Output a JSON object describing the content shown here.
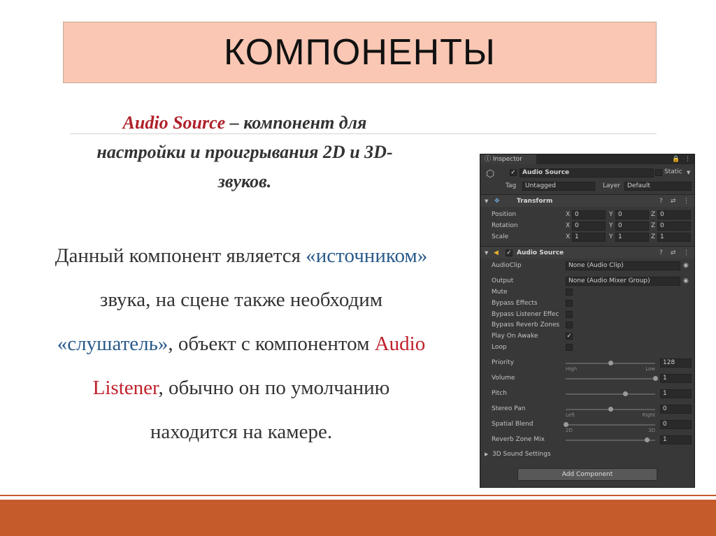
{
  "slide": {
    "title": "КОМПОНЕНТЫ",
    "para1": {
      "term": "Audio Source",
      "rest_line1": " – компонент для",
      "line2": "настройки и проигрывания 2D и 3D-",
      "line3": "звуков."
    },
    "para2": {
      "l1_a": "Данный компонент является ",
      "l1_b": "«источником»",
      "l2": "звука, на сцене также необходим",
      "l3_a": "«слушатель»",
      "l3_b": ", объект с компонентом ",
      "l3_c": "Audio",
      "l4_a": "Listener",
      "l4_b": ", обычно он по умолчанию",
      "l5": "находится на камере."
    }
  },
  "inspector": {
    "tab": "Inspector",
    "object_name": "Audio Source",
    "static_label": "Static",
    "tag_label": "Tag",
    "tag_value": "Untagged",
    "layer_label": "Layer",
    "layer_value": "Default",
    "transform": {
      "title": "Transform",
      "rows": [
        {
          "label": "Position",
          "x": "0",
          "y": "0",
          "z": "0"
        },
        {
          "label": "Rotation",
          "x": "0",
          "y": "0",
          "z": "0"
        },
        {
          "label": "Scale",
          "x": "1",
          "y": "1",
          "z": "1"
        }
      ],
      "axes": [
        "X",
        "Y",
        "Z"
      ]
    },
    "audio_source": {
      "title": "Audio Source",
      "audioclip_label": "AudioClip",
      "audioclip_value": "None (Audio Clip)",
      "output_label": "Output",
      "output_value": "None (Audio Mixer Group)",
      "toggles": [
        {
          "label": "Mute",
          "checked": false
        },
        {
          "label": "Bypass Effects",
          "checked": false
        },
        {
          "label": "Bypass Listener Effec",
          "checked": false
        },
        {
          "label": "Bypass Reverb Zones",
          "checked": false
        },
        {
          "label": "Play On Awake",
          "checked": true
        },
        {
          "label": "Loop",
          "checked": false
        }
      ],
      "sliders": [
        {
          "label": "Priority",
          "value": "128",
          "level": 0.5,
          "left_hint": "High",
          "right_hint": "Low"
        },
        {
          "label": "Volume",
          "value": "1",
          "level": 1.0
        },
        {
          "label": "Pitch",
          "value": "1",
          "level": 0.67
        },
        {
          "label": "Stereo Pan",
          "value": "0",
          "level": 0.5,
          "left_hint": "Left",
          "right_hint": "Right"
        },
        {
          "label": "Spatial Blend",
          "value": "0",
          "level": 0.0,
          "left_hint": "2D",
          "right_hint": "3D"
        },
        {
          "label": "Reverb Zone Mix",
          "value": "1",
          "level": 0.91
        }
      ],
      "sound_settings": "3D Sound Settings"
    },
    "add_component": "Add Component"
  }
}
